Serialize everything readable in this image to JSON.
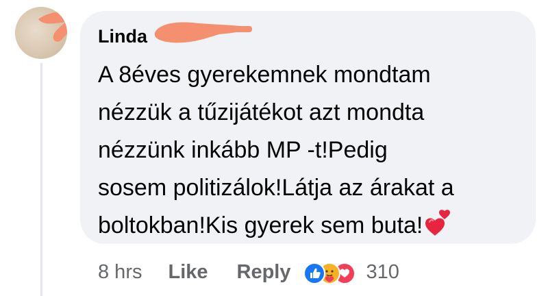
{
  "comment": {
    "author": "Linda",
    "text_lines": [
      "A 8éves gyerekemnek mondtam",
      "nézzük a tűzijátékot azt mondta",
      "nézzünk inkább MP -t!Pedig",
      "sosem politizálok!Látja az árakat a",
      "boltokban!Kis gyerek sem buta!"
    ],
    "trailing_emoji": "heart-exclamation-emoji"
  },
  "actions": {
    "time": "8 hrs",
    "like_label": "Like",
    "reply_label": "Reply",
    "reaction_count": "310",
    "reaction_types": [
      "like",
      "care",
      "love"
    ]
  },
  "colors": {
    "bubble": "#f0f2f5",
    "text": "#050505",
    "meta": "#65676b",
    "redaction": "#f4906f",
    "like": "#1877f2",
    "love": "#f33e58",
    "care": "#f7b125"
  }
}
